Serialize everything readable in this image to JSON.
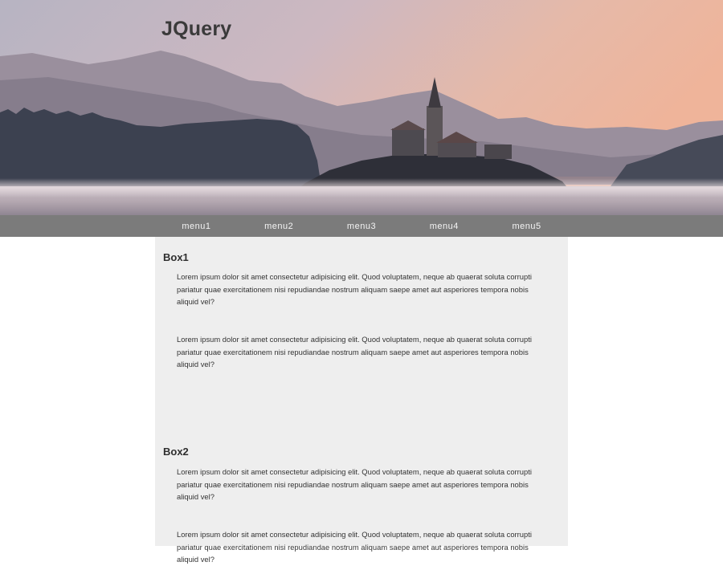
{
  "header": {
    "title": "JQuery",
    "hero_image": "landscape-lake-church-mountains-image"
  },
  "nav": {
    "items": [
      {
        "label": "menu1"
      },
      {
        "label": "menu2"
      },
      {
        "label": "menu3"
      },
      {
        "label": "menu4"
      },
      {
        "label": "menu5"
      }
    ]
  },
  "boxes": [
    {
      "title": "Box1",
      "paragraphs": [
        "Lorem ipsum dolor sit amet consectetur adipisicing elit. Quod voluptatem, neque ab quaerat soluta corrupti pariatur quae exercitationem nisi repudiandae nostrum aliquam saepe amet aut asperiores tempora nobis aliquid vel?",
        "Lorem ipsum dolor sit amet consectetur adipisicing elit. Quod voluptatem, neque ab quaerat soluta corrupti pariatur quae exercitationem nisi repudiandae nostrum aliquam saepe amet aut asperiores tempora nobis aliquid vel?"
      ]
    },
    {
      "title": "Box2",
      "paragraphs": [
        "Lorem ipsum dolor sit amet consectetur adipisicing elit. Quod voluptatem, neque ab quaerat soluta corrupti pariatur quae exercitationem nisi repudiandae nostrum aliquam saepe amet aut asperiores tempora nobis aliquid vel?",
        "Lorem ipsum dolor sit amet consectetur adipisicing elit. Quod voluptatem, neque ab quaerat soluta corrupti pariatur quae exercitationem nisi repudiandae nostrum aliquam saepe amet aut asperiores tempora nobis aliquid vel?"
      ]
    }
  ],
  "colors": {
    "nav_background": "#7b7b7b",
    "content_background": "#eeeeee",
    "title_text": "#3a3a3a"
  }
}
